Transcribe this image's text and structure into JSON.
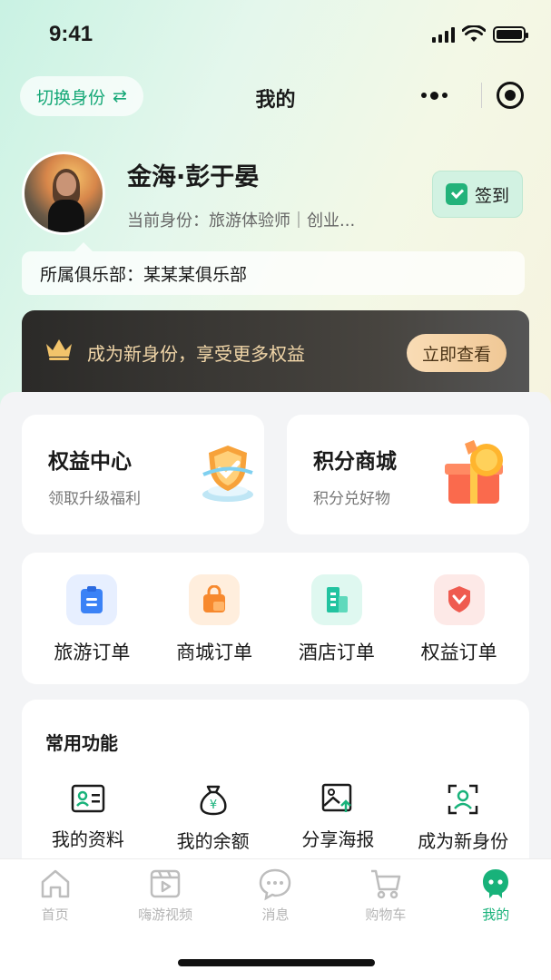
{
  "status": {
    "time": "9:41"
  },
  "nav": {
    "switch_label": "切换身份",
    "switch_arrow": "⇄",
    "title": "我的"
  },
  "profile": {
    "name": "金海·彭于晏",
    "identity": "当前身份：旅游体验师｜创业...",
    "signin_label": "签到",
    "club": "所属俱乐部：某某某俱乐部"
  },
  "vip": {
    "text": "成为新身份，享受更多权益",
    "button": "立即查看"
  },
  "features": [
    {
      "title": "权益中心",
      "sub": "领取升级福利",
      "icon": "shield-check-icon"
    },
    {
      "title": "积分商城",
      "sub": "积分兑好物",
      "icon": "gift-coin-icon"
    }
  ],
  "orders": [
    {
      "label": "旅游订单",
      "icon": "clipboard-icon",
      "color": "#3b82f6",
      "bg": "#e7efff"
    },
    {
      "label": "商城订单",
      "icon": "shopping-bag-icon",
      "color": "#f7892e",
      "bg": "#ffeedd"
    },
    {
      "label": "酒店订单",
      "icon": "building-icon",
      "color": "#22c3a0",
      "bg": "#dff8f0"
    },
    {
      "label": "权益订单",
      "icon": "badge-icon",
      "color": "#ef5b50",
      "bg": "#fde9e7"
    }
  ],
  "common": {
    "title": "常用功能",
    "items": [
      {
        "label": "我的资料",
        "icon": "id-card-icon"
      },
      {
        "label": "我的余额",
        "icon": "money-bag-icon"
      },
      {
        "label": "分享海报",
        "icon": "image-share-icon"
      },
      {
        "label": "成为新身份",
        "icon": "user-scan-icon"
      }
    ]
  },
  "tabs": [
    {
      "label": "首页",
      "icon": "home-icon"
    },
    {
      "label": "嗨游视频",
      "icon": "video-icon"
    },
    {
      "label": "消息",
      "icon": "message-icon"
    },
    {
      "label": "购物车",
      "icon": "cart-icon"
    },
    {
      "label": "我的",
      "icon": "mine-icon",
      "active": true
    }
  ],
  "colors": {
    "accent": "#18b27a",
    "vip_text": "#f1d6a8"
  }
}
